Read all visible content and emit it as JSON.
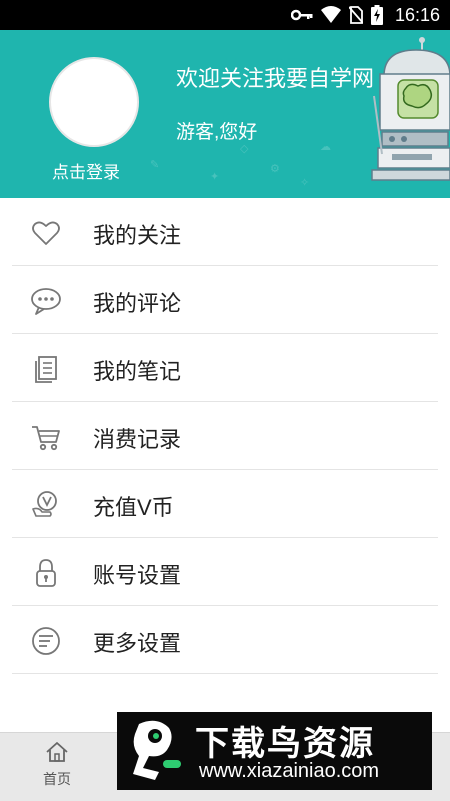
{
  "status_bar": {
    "time": "16:16",
    "icons": [
      "key-icon",
      "wifi-icon",
      "no-sim-icon",
      "battery-charging-icon"
    ]
  },
  "header": {
    "login_text": "点击登录",
    "welcome": "欢迎关注我要自学网",
    "greeting": "游客,您好",
    "background_color": "#1fb5ae"
  },
  "menu": {
    "items": [
      {
        "label": "我的关注",
        "icon": "heart-icon"
      },
      {
        "label": "我的评论",
        "icon": "comment-icon"
      },
      {
        "label": "我的笔记",
        "icon": "notes-icon"
      },
      {
        "label": "消费记录",
        "icon": "cart-icon"
      },
      {
        "label": "充值V币",
        "icon": "recharge-icon"
      },
      {
        "label": "账号设置",
        "icon": "lock-icon"
      },
      {
        "label": "更多设置",
        "icon": "more-settings-icon"
      }
    ]
  },
  "tabbar": {
    "home_label": "首页"
  },
  "watermark": {
    "title": "下载鸟资源",
    "url": "www.xiazainiao.com"
  }
}
